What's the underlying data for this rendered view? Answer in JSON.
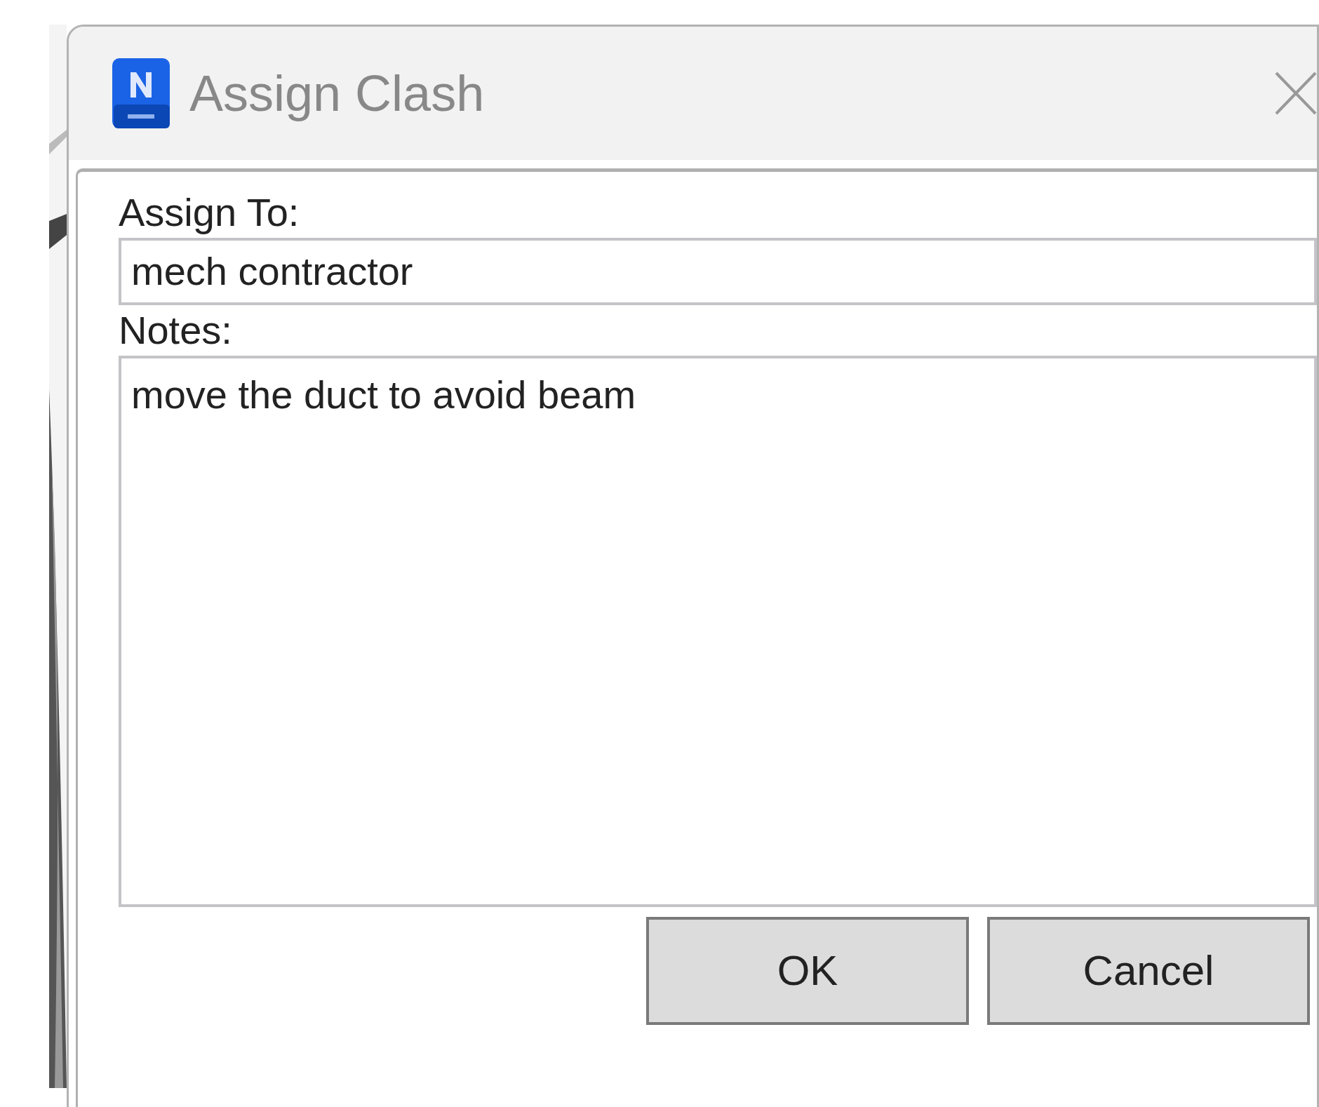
{
  "window": {
    "title": "Assign Clash"
  },
  "fields": [
    {
      "label": "Assign To:",
      "value": "mech contractor",
      "kind": "line"
    },
    {
      "label": "Notes:",
      "value": "move the duct to avoid beam",
      "kind": "area"
    }
  ],
  "buttons": [
    "OK",
    "Cancel"
  ]
}
